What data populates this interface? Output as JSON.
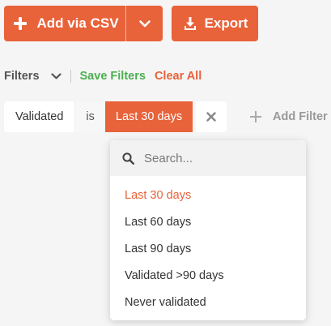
{
  "toolbar": {
    "add_csv_label": "Add via CSV",
    "export_label": "Export"
  },
  "filters": {
    "label": "Filters",
    "save_label": "Save Filters",
    "clear_label": "Clear All"
  },
  "active_filter": {
    "field": "Validated",
    "operator": "is",
    "value": "Last 30 days"
  },
  "add_filter_label": "Add Filter",
  "dropdown": {
    "search_placeholder": "Search...",
    "options": [
      "Last 30 days",
      "Last 60 days",
      "Last 90 days",
      "Validated >90 days",
      "Never validated"
    ],
    "selected": "Last 30 days"
  },
  "colors": {
    "accent": "#e8623a",
    "save_green": "#4caf50"
  },
  "icons": [
    "plus-icon",
    "chevron-down-icon",
    "download-icon",
    "close-icon",
    "search-icon"
  ]
}
